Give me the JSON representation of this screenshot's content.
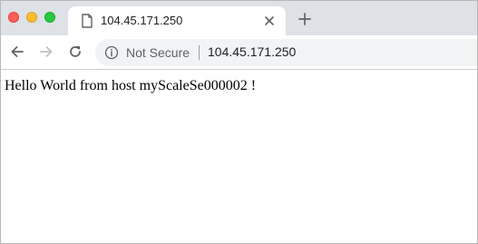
{
  "window_controls": [
    "close",
    "minimize",
    "maximize"
  ],
  "tab": {
    "title": "104.45.171.250",
    "icon": "page-icon",
    "close_icon": "close-icon"
  },
  "new_tab_icon": "plus-icon",
  "toolbar": {
    "back_icon": "back-arrow-icon",
    "forward_icon": "forward-arrow-icon",
    "reload_icon": "reload-icon"
  },
  "address_bar": {
    "security_icon": "info-icon",
    "security_label": "Not Secure",
    "url": "104.45.171.250"
  },
  "page": {
    "text": "Hello World from host myScaleSe000002 !"
  },
  "colors": {
    "tabstrip": "#dee1e6",
    "omnibox": "#f1f3f4",
    "close": "#fe5f57",
    "minimize": "#febc2e",
    "maximize": "#28c840"
  }
}
